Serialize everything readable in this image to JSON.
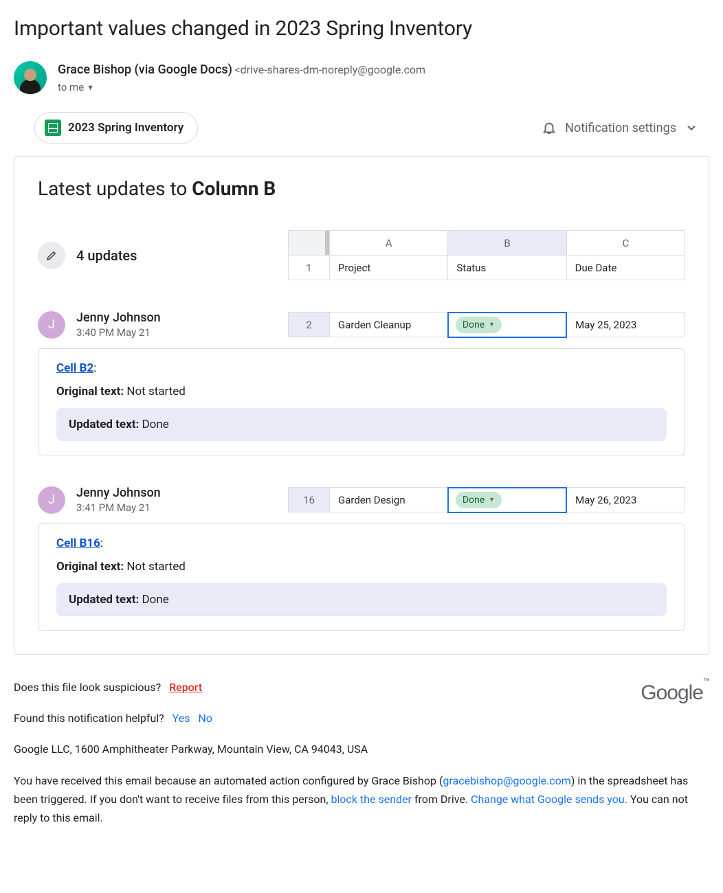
{
  "subject": "Important values changed in 2023 Spring Inventory",
  "sender": {
    "name": "Grace Bishop (via Google Docs)",
    "email": "<drive-shares-dm-noreply@google.com",
    "to": "to me"
  },
  "file_chip": "2023 Spring Inventory",
  "notif_settings_label": "Notification settings",
  "card": {
    "title_prefix": "Latest updates to ",
    "title_bold": "Column B",
    "updates_count": "4 updates",
    "header_cols": [
      "A",
      "B",
      "C"
    ],
    "header_rownum": "1",
    "header_cells": [
      "Project",
      "Status",
      "Due Date"
    ]
  },
  "updates": [
    {
      "avatar_initial": "J",
      "user": "Jenny Johnson",
      "time": "3:40 PM May 21",
      "rownum": "2",
      "cells": [
        "Garden Cleanup",
        "Done",
        "May 25, 2023"
      ],
      "cell_link": "Cell B2",
      "original_label": "Original text:",
      "original_value": " Not started",
      "updated_label": "Updated text:",
      "updated_value": " Done"
    },
    {
      "avatar_initial": "J",
      "user": "Jenny Johnson",
      "time": "3:41 PM May 21",
      "rownum": "16",
      "cells": [
        "Garden Design",
        "Done",
        "May 26, 2023"
      ],
      "cell_link": "Cell B16",
      "original_label": "Original text:",
      "original_value": " Not started",
      "updated_label": "Updated text:",
      "updated_value": " Done"
    }
  ],
  "footer": {
    "suspicious": "Does this file look suspicious?",
    "report": "Report",
    "helpful": "Found this notification helpful?",
    "yes": "Yes",
    "no": "No",
    "address": "Google LLC, 1600 Amphitheater Parkway, Mountain View, CA 94043, USA",
    "p1": "You have received this email because an automated action configured by Grace Bishop (",
    "email": "gracebishop@google.com",
    "p2": ") in the spreadsheet has been triggered. If you don't want to receive files from this person, ",
    "block": "block the sender",
    "p3": " from Drive. ",
    "change": "Change what Google sends you.",
    "p4": " You can not reply to this email.",
    "logo": "Google"
  }
}
